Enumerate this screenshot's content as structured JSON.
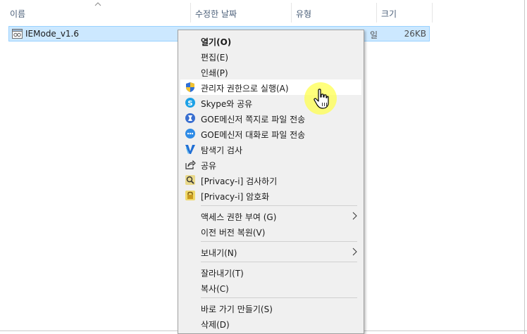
{
  "header": {
    "columns": [
      {
        "label": "이름"
      },
      {
        "label": "수정한 날짜"
      },
      {
        "label": "유형"
      },
      {
        "label": "크기"
      }
    ]
  },
  "file": {
    "name": "IEMode_v1.6",
    "type_fragment": "일",
    "size": "26KB"
  },
  "menu": {
    "items": [
      {
        "label": "열기(O)",
        "icon": "none"
      },
      {
        "label": "편집(E)",
        "icon": "none"
      },
      {
        "label": "인쇄(P)",
        "icon": "none"
      },
      {
        "label": "관리자 권한으로 실행(A)",
        "icon": "uac-shield-icon"
      },
      {
        "label": "Skype와 공유",
        "icon": "skype-icon"
      },
      {
        "label": "GOE메신저 쪽지로 파일 전송",
        "icon": "goe-note-icon"
      },
      {
        "label": "GOE메신저 대화로 파일 전송",
        "icon": "goe-chat-icon"
      },
      {
        "label": "탐색기 검사",
        "icon": "v3-scan-icon"
      },
      {
        "label": "공유",
        "icon": "share-icon"
      },
      {
        "label": "[Privacy-i] 검사하기",
        "icon": "privacy-scan-icon"
      },
      {
        "label": "[Privacy-i] 암호화",
        "icon": "privacy-lock-icon"
      },
      {
        "label": "액세스 권한 부여 (G)",
        "icon": "none"
      },
      {
        "label": "이전 버전 복원(V)",
        "icon": "none"
      },
      {
        "label": "보내기(N)",
        "icon": "none"
      },
      {
        "label": "잘라내기(T)",
        "icon": "none"
      },
      {
        "label": "복사(C)",
        "icon": "none"
      },
      {
        "label": "바로 가기 만들기(S)",
        "icon": "none"
      },
      {
        "label": "삭제(D)",
        "icon": "none"
      }
    ]
  },
  "colors": {
    "selection": "#cce8ff",
    "menu_bg": "#f0f0f0",
    "header_text": "#4c607a"
  }
}
